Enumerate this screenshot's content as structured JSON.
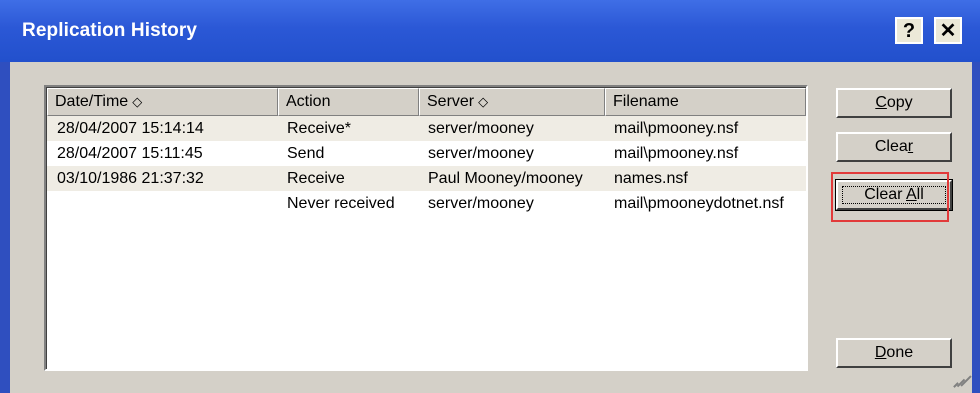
{
  "window": {
    "title": "Replication History"
  },
  "titlebar_buttons": {
    "help": "?",
    "close": "✕"
  },
  "columns": [
    {
      "label": "Date/Time",
      "sort": "◇"
    },
    {
      "label": "Action",
      "sort": ""
    },
    {
      "label": "Server",
      "sort": "◇"
    },
    {
      "label": "Filename",
      "sort": ""
    }
  ],
  "rows": [
    {
      "datetime": "28/04/2007 15:14:14",
      "action": "Receive*",
      "server": "server/mooney",
      "filename": "mail\\pmooney.nsf"
    },
    {
      "datetime": "28/04/2007 15:11:45",
      "action": "Send",
      "server": "server/mooney",
      "filename": "mail\\pmooney.nsf"
    },
    {
      "datetime": "03/10/1986 21:37:32",
      "action": "Receive",
      "server": "Paul Mooney/mooney",
      "filename": "names.nsf"
    },
    {
      "datetime": "",
      "action": "Never received",
      "server": "server/mooney",
      "filename": "mail\\pmooneydotnet.nsf"
    }
  ],
  "buttons": {
    "copy": {
      "pre": "",
      "mnemonic": "C",
      "post": "opy"
    },
    "clear": {
      "pre": "Clea",
      "mnemonic": "r",
      "post": ""
    },
    "clear_all": {
      "pre": "Clear ",
      "mnemonic": "A",
      "post": "ll"
    },
    "done": {
      "pre": "",
      "mnemonic": "D",
      "post": "one"
    }
  }
}
